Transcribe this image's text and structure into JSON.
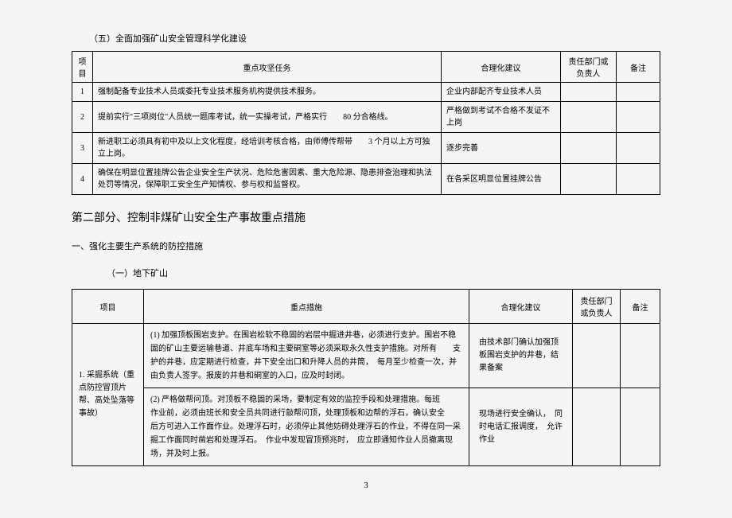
{
  "section5_title": "（五）全面加强矿山安全管理科学化建设",
  "table1": {
    "headers": {
      "num": "项目",
      "task": "重点攻坚任务",
      "suggest": "合理化建议",
      "dept": "责任部门或负责人",
      "note": "备注"
    },
    "rows": [
      {
        "num": "1",
        "task": "强制配备专业技术人员或委托专业技术服务机构提供技术服务。",
        "suggest": "企业内部配齐专业技术人员"
      },
      {
        "num": "2",
        "task": "提前实行\"三项岗位\"人员统一题库考试，统一实操考试，严格实行　　80 分合格线。",
        "suggest": "严格做到考试不合格不发证不上岗"
      },
      {
        "num": "3",
        "task": "新进职工必须具有初中及以上文化程度，经培训考核合格，由师傅传帮带　　3 个月以上方可独立上岗。",
        "suggest": "逐步完善"
      },
      {
        "num": "4",
        "task": "确保在明显位置挂牌公告企业安全生产状况、危险危害因素、重大危险源、隐患排查治理和执法处罚等情况，保障职工安全生产知情权、参与权和监督权。",
        "suggest": "在各采区明显位置挂牌公告"
      }
    ]
  },
  "part2_title": "第二部分、控制非煤矿山安全生产事故重点措施",
  "sub_heading": "一、强化主要生产系统的防控措施",
  "sub_sub_heading": "（一）地下矿山",
  "table2": {
    "headers": {
      "item": "项目",
      "measure": "重点措施",
      "suggest": "合理化建议",
      "dept": "责任部门或负责人",
      "note": "备注"
    },
    "item_label": "1. 采掘系统（重点防控冒顶片帮、高处坠落等事故）",
    "rows": [
      {
        "measure": "(1) 加强顶板围岩支护。在围岩松软不稳固的岩层中掘进井巷，必须进行支护。围岩不稳固的矿山主要运输巷道、井底车场和主要硐室等必须采取永久性支护措施。对所有　　支护的井巷，应定期进行检查，井下安全出口和升降人员的井筒，　每月至少检查一次，并由负责人签字。报废的井巷和硐室的入口，应及时封闭。",
        "suggest": "由技术部门确认加强顶板围岩支护的井巷，结果备案"
      },
      {
        "measure": "(2) 严格做帮问顶。对顶板不稳固的采场，要制定有效的监控手段和处理措施。每班　　作业前，必须由班长和安全员共同进行敲帮问顶，处理顶板和边帮的浮石，确认安全　　后方可进入工作面作业。处理浮石时，必须停止其他妨碍处理浮石的作业，不得在同一采掘工作面同时凿岩和处理浮石。　作业中发现冒顶预兆时，　应立即通知作业人员撤离现场，并及时上报。",
        "suggest": "现场进行安全确认，　同时电话汇报调度，　允许作业"
      }
    ]
  },
  "page_number": "3"
}
